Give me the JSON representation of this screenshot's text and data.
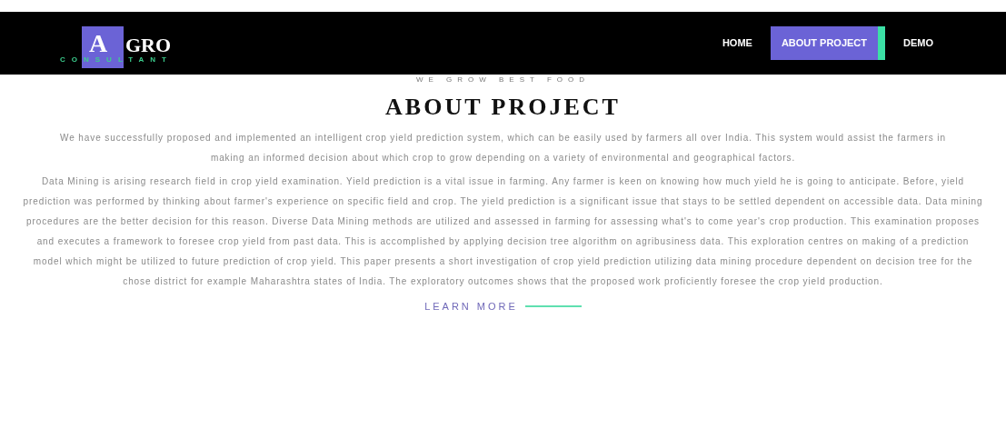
{
  "logo": {
    "initial": "A",
    "name": "GRO",
    "subtitle": "CONSULTANT"
  },
  "nav": [
    {
      "label": "HOME",
      "selected": false
    },
    {
      "label": "ABOUT PROJECT",
      "selected": true
    },
    {
      "label": "DEMO",
      "selected": false
    }
  ],
  "tagline": "WE GROW BEST FOOD",
  "heading": "ABOUT PROJECT",
  "paragraphs": [
    "We have successfully proposed and implemented an intelligent crop yield prediction system, which can be easily used by farmers all over India. This system would assist the farmers in making an informed decision about which crop to grow depending on a variety of environmental and geographical factors.",
    "Data Mining is arising research field in crop yield examination. Yield prediction is a vital issue in farming. Any farmer is keen on knowing how much yield he is going to anticipate. Before, yield prediction was performed by thinking about farmer's experience on specific field and crop. The yield prediction is a significant issue that stays to be settled dependent on accessible data. Data mining procedures are the better decision for this reason. Diverse Data Mining methods are utilized and assessed in farming for assessing what's to come year's crop production. This examination proposes and executes a framework to foresee crop yield from past data. This is accomplished by applying decision tree algorithm on agribusiness data. This exploration centres on making of a prediction model which might be utilized to future prediction of crop yield. This paper presents a short investigation of crop yield prediction utilizing data mining procedure dependent on decision tree for the chose district for example Maharashtra states of India. The exploratory outcomes shows that the proposed work proficiently foresee the crop yield production."
  ],
  "link": "LEARN MORE"
}
